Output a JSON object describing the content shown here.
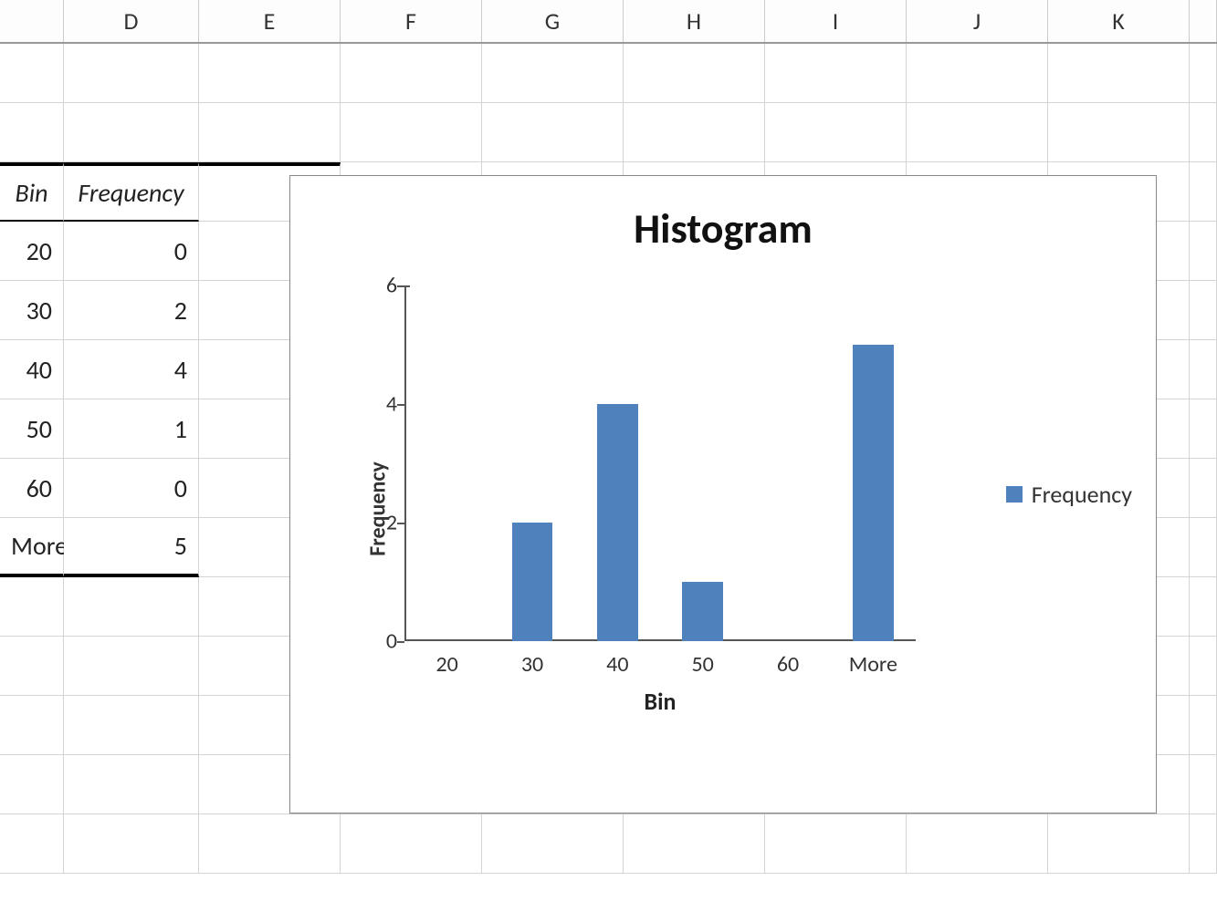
{
  "columns": [
    "D",
    "E",
    "F",
    "G",
    "H",
    "I",
    "J",
    "K"
  ],
  "table": {
    "header": {
      "bin": "Bin",
      "freq": "Frequency"
    },
    "rows": [
      {
        "bin": "20",
        "freq": "0"
      },
      {
        "bin": "30",
        "freq": "2"
      },
      {
        "bin": "40",
        "freq": "4"
      },
      {
        "bin": "50",
        "freq": "1"
      },
      {
        "bin": "60",
        "freq": "0"
      },
      {
        "bin": "More",
        "freq": "5"
      }
    ]
  },
  "chart": {
    "title": "Histogram",
    "ylabel": "Frequency",
    "xlabel": "Bin",
    "legend": "Frequency",
    "bar_color": "#4f81bd"
  },
  "chart_data": {
    "type": "bar",
    "title": "Histogram",
    "xlabel": "Bin",
    "ylabel": "Frequency",
    "categories": [
      "20",
      "30",
      "40",
      "50",
      "60",
      "More"
    ],
    "series": [
      {
        "name": "Frequency",
        "values": [
          0,
          2,
          4,
          1,
          0,
          5
        ]
      }
    ],
    "ylim": [
      0,
      6
    ],
    "yticks": [
      0,
      2,
      4,
      6
    ],
    "grid": false,
    "legend_position": "right"
  }
}
